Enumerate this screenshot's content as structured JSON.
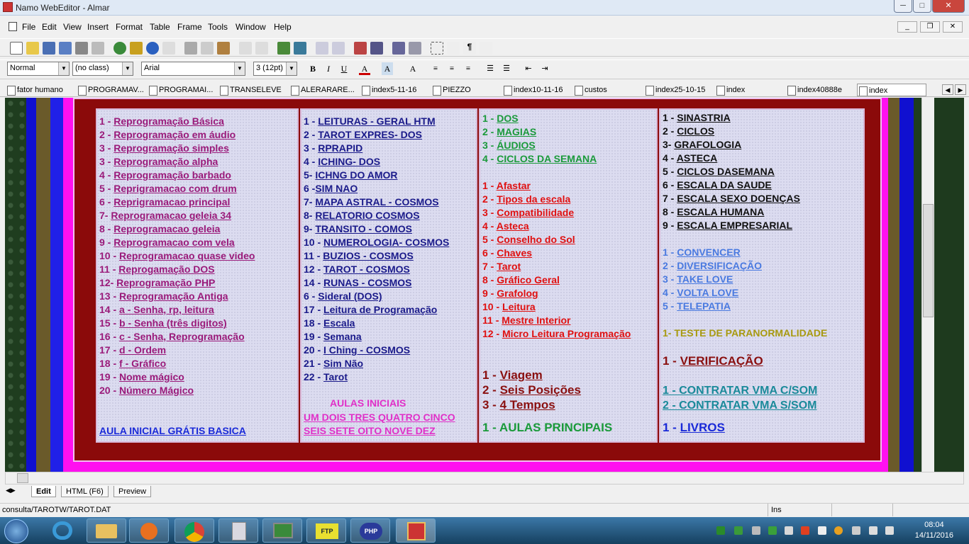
{
  "window": {
    "title": "Namo WebEditor - Almar",
    "min": "─",
    "max": "□",
    "close": "✕"
  },
  "menu": [
    "File",
    "Edit",
    "View",
    "Insert",
    "Format",
    "Table",
    "Frame",
    "Tools",
    "Window",
    "Help"
  ],
  "mdi": {
    "min": "_",
    "restore": "❐",
    "close": "✕"
  },
  "format": {
    "style": "Normal",
    "class": "(no class)",
    "font": "Arial",
    "size": "3  (12pt)",
    "bold": "B",
    "italic": "I",
    "underline": "U"
  },
  "doctabs": [
    "fator humano",
    "PROGRAMAV...",
    "PROGRAMAI...",
    "TRANSELEVE",
    "ALERARARE...",
    "index5-11-16",
    "PIEZZO",
    "index10-11-16",
    "custos",
    "index25-10-15",
    "index",
    "index40888e",
    "index"
  ],
  "col1": {
    "lines": [
      [
        "1 - ",
        "Reprogramação Básica"
      ],
      [
        "2 - ",
        "Reprogramação em áudio"
      ],
      [
        "3 - ",
        "Reprogramação simples"
      ],
      [
        "3 - ",
        "Reprogramação alpha"
      ],
      [
        "4 - ",
        "Reprogramação barbado"
      ],
      [
        "5 - ",
        "Reprigramacao com drum"
      ],
      [
        "6 - ",
        "Reprigramacao principal"
      ],
      [
        "7- ",
        "Reprogramacao geleia 34"
      ],
      [
        "8 - ",
        "Reprogramacao geleia"
      ],
      [
        "9 - ",
        "Reprogramacao com vela"
      ],
      [
        "10 - ",
        "Reprogramacao quase video"
      ],
      [
        "11 - ",
        "Reprogamação DOS"
      ],
      [
        "12- ",
        "Reprogramação PHP"
      ],
      [
        "13 - ",
        "Reprogramação Antiga"
      ],
      [
        "14 - ",
        "a - Senha, rp, leitura"
      ],
      [
        "15 - ",
        "b - Senha (três digitos) "
      ],
      [
        "16 - ",
        "c - Senha, Reprogramação"
      ],
      [
        "17 - ",
        "d - Ordem"
      ],
      [
        "18 - ",
        "f -  Gráfico"
      ],
      [
        "19 - ",
        "Nome mágico"
      ],
      [
        "20 - ",
        "Número Mágico"
      ]
    ],
    "bottom": "AULA INICIAL GRÁTIS  BASICA"
  },
  "col2": {
    "lines": [
      [
        "1 - ",
        "LEITURAS - GERAL HTM"
      ],
      [
        "2 - ",
        "TAROT EXPRES- DOS"
      ],
      [
        "3 - ",
        "RPRAPID"
      ],
      [
        "4 - ",
        "ICHING- DOS"
      ],
      [
        "5- ",
        "ICHNG DO AMOR"
      ],
      [
        "6 -",
        "SIM NAO"
      ],
      [
        "7- ",
        "MAPA ASTRAL  - COSMOS"
      ],
      [
        "8- ",
        "RELATORIO COSMOS"
      ],
      [
        "9- ",
        "TRANSITO - COMOS"
      ],
      [
        "10 - ",
        "NUMEROLOGIA- COSMOS"
      ],
      [
        "11 - ",
        "BUZIOS - COSMOS"
      ],
      [
        "12 - ",
        "TAROT - COSMOS"
      ],
      [
        "14 - ",
        "RUNAS - COSMOS"
      ],
      [
        "6 - ",
        "  Sideral (DOS)"
      ],
      [
        "17 - ",
        "Leitura de Programação"
      ],
      [
        "18 - ",
        "Escala "
      ],
      [
        "19 - ",
        "Semana "
      ],
      [
        "20 - ",
        "I Ching - COSMOS"
      ],
      [
        "21 - ",
        "Sim Não"
      ],
      [
        "22 - ",
        "Tarot"
      ]
    ],
    "aulas": "AULAS INICIAIS",
    "row1": "UM DOIS TRES QUATRO CINCO",
    "row2": "SEIS SETE OITO NOVE DEZ"
  },
  "col3": {
    "green": [
      [
        "1 - ",
        "DOS"
      ],
      [
        "2 - ",
        "MAGIAS"
      ],
      [
        "3 - ",
        "ÁUDIOS"
      ],
      [
        "4 - ",
        "CICLOS DA SEMANA"
      ]
    ],
    "red": [
      [
        "1 - ",
        "Afastar "
      ],
      [
        "2 - ",
        "Tipos da escala"
      ],
      [
        "3 - ",
        "Compatibilidade"
      ],
      [
        "4 - ",
        "Asteca"
      ],
      [
        "5 - ",
        "Conselho do Sol"
      ],
      [
        "6 - ",
        "Chaves"
      ],
      [
        "7 - ",
        "Tarot"
      ],
      [
        "8 - ",
        "Gráfico Geral"
      ],
      [
        "9 - ",
        "Grafolog"
      ],
      [
        "10 - ",
        "Leitura"
      ],
      [
        "11 - ",
        "Mestre Interior"
      ],
      [
        "12 - ",
        "Micro Leitura Programação"
      ]
    ],
    "big": [
      [
        "1 - ",
        "Viagem"
      ],
      [
        "2 - ",
        "Seis Posições"
      ],
      [
        "3 - ",
        "4 Tempos"
      ]
    ],
    "bottom": "1 - AULAS PRINCIPAIS"
  },
  "col4": {
    "black": [
      [
        "1 - ",
        "SINASTRIA"
      ],
      [
        "2 - ",
        "CICLOS"
      ],
      [
        "3- ",
        "GRAFOLOGIA"
      ],
      [
        "4 - ",
        "ASTECA"
      ],
      [
        "5 - ",
        "CICLOS DASEMANA"
      ],
      [
        "6 - ",
        "ESCALA DA SAUDE"
      ],
      [
        "7 - ",
        "ESCALA SEXO DOENÇAS"
      ],
      [
        "8 - ",
        "ESCALA HUMANA"
      ],
      [
        "9 - ",
        "ESCALA EMPRESARIAL"
      ]
    ],
    "blue": [
      [
        "1 - ",
        "CONVENCER"
      ],
      [
        "2 - ",
        "DIVERSIFICAÇÃO"
      ],
      [
        "3 - ",
        "TAKE LOVE"
      ],
      [
        "4 - ",
        "VOLTA LOVE"
      ],
      [
        "5 - ",
        "TELEPATIA"
      ]
    ],
    "teste": "1- TESTE DE PARANORMALIDADE",
    "verif": [
      "1 - ",
      "VERIFICAÇÃO"
    ],
    "contr1": "1 - CONTRATAR VMA C/SOM",
    "contr2": "2 - CONTRATAR VMA S/SOM",
    "livros": [
      "1 - ",
      "LIVROS"
    ]
  },
  "viewtabs": [
    "Edit",
    "HTML (F6)",
    "Preview"
  ],
  "status": {
    "path": "consulta/TAROTW/TAROT.DAT",
    "mode": "Ins"
  },
  "clock": {
    "time": "08:04",
    "date": "14/11/2016"
  }
}
